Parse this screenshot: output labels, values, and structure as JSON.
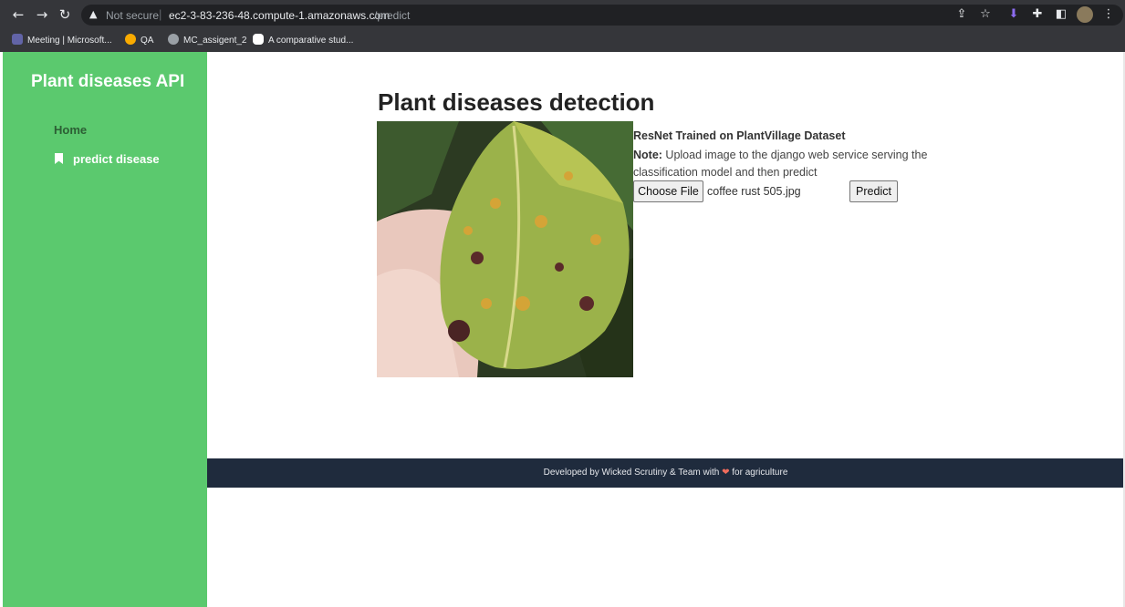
{
  "browser": {
    "not_secure": "Not secure",
    "url_host": "ec2-3-83-236-48.compute-1.amazonaws.com",
    "url_path": "/predict",
    "icons": [
      "back-icon",
      "forward-icon",
      "reload-icon",
      "warning-icon",
      "share-icon",
      "star-icon",
      "download-icon",
      "extensions-icon",
      "sidepanel-icon",
      "profile-avatar",
      "menu-icon"
    ]
  },
  "bookmarks": [
    {
      "label": "Meeting | Microsoft...",
      "icon": "teams-icon",
      "color": "#6264a7"
    },
    {
      "label": "QA",
      "icon": "colab-icon",
      "color": "#f9ab00"
    },
    {
      "label": "MC_assigent_2",
      "icon": "globe-icon",
      "color": "#9aa0a6"
    },
    {
      "label": "A comparative stud...",
      "icon": "medium-icon",
      "color": "#ffffff"
    }
  ],
  "sidebar": {
    "brand": "Plant diseases API",
    "home": "Home",
    "predict": "predict disease"
  },
  "main": {
    "title": "Plant diseases detection",
    "model_name": "ResNet Trained on PlantVillage Dataset",
    "note_label": "Note:",
    "note_text": " Upload image to the django web service serving the classification model and then predict",
    "choose_file": "Choose File",
    "file_name": "coffee rust 505.jpg",
    "predict": "Predict"
  },
  "footer": {
    "text_before": "Developed by Wicked Scrutiny & Team with ",
    "heart": "❤",
    "text_after": " for agriculture"
  },
  "colors": {
    "sidebar": "#5bc96e",
    "footer": "#1f2b3d",
    "chrome": "#35363a"
  }
}
